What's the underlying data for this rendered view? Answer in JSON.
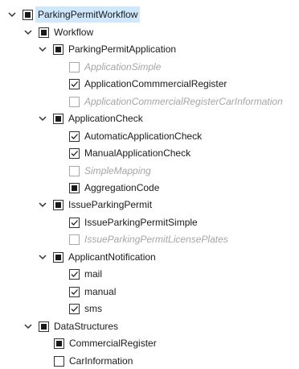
{
  "tree": {
    "root": {
      "label": "ParkingPermitWorkflow",
      "workflow": {
        "label": "Workflow",
        "parking_permit_application": {
          "label": "ParkingPermitApplication",
          "items": [
            "ApplicationSimple",
            "ApplicationCommmercialRegister",
            "ApplicationCommercialRegisterCarInformation"
          ]
        },
        "application_check": {
          "label": "ApplicationCheck",
          "items": [
            "AutomaticApplicationCheck",
            "ManualApplicationCheck",
            "SimpleMapping",
            "AggregationCode"
          ]
        },
        "issue_parking_permit": {
          "label": "IssueParkingPermit",
          "items": [
            "IssueParkingPermitSimple",
            "IssueParkingPermitLicensePlates"
          ]
        },
        "applicant_notification": {
          "label": "ApplicantNotification",
          "items": [
            "mail",
            "manual",
            "sms"
          ]
        }
      },
      "data_structures": {
        "label": "DataStructures",
        "items": [
          "CommercialRegister",
          "CarInformation"
        ]
      }
    }
  },
  "icons": {
    "expander": "chevron-down-icon",
    "check": "checkmark-icon"
  },
  "colors": {
    "selection_bg": "#cfe8fb",
    "disabled_text": "#a5a5a5",
    "checkbox_border": "#333333"
  }
}
